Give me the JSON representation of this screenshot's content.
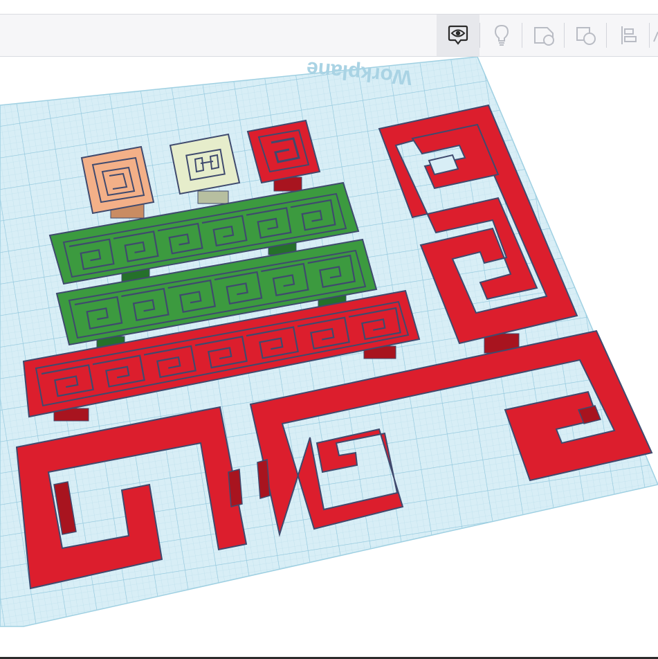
{
  "toolbar": {
    "tools": [
      {
        "name": "show-all-icon",
        "active": true
      },
      {
        "name": "lightbulb-icon",
        "active": false
      },
      {
        "name": "note-icon",
        "active": false
      },
      {
        "name": "shape-combine-icon",
        "active": false
      },
      {
        "name": "align-icon",
        "active": false
      },
      {
        "name": "ruler-icon",
        "active": false
      }
    ]
  },
  "workplane": {
    "label": "Workplane",
    "grid_color": "#bfe3f0",
    "fill_color": "#d8eef6"
  },
  "colors": {
    "red": "#dc1e2d",
    "red_dark": "#a8141f",
    "green": "#3c9a3f",
    "green_dark": "#25702a",
    "orange": "#f3b088",
    "cream": "#e6edcb",
    "outline": "#3f4a6e"
  },
  "objects": [
    "orange-spiral-tile",
    "cream-key-tile",
    "small-red-spiral",
    "green-bar-top",
    "green-bar-middle",
    "red-bar-long",
    "red-spiral-large-right",
    "red-spiral-bottom-left",
    "red-spiral-bottom-center"
  ]
}
